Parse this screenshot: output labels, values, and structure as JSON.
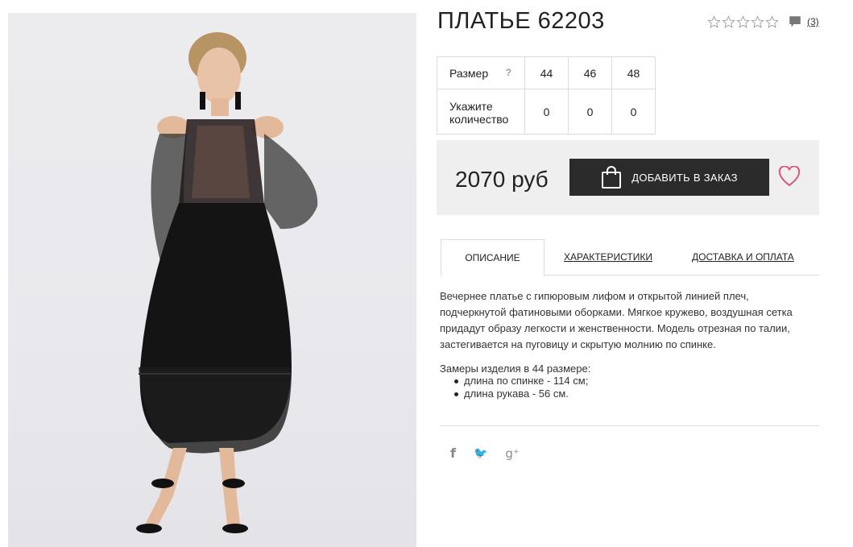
{
  "product": {
    "title": "ПЛАТЬЕ 62203",
    "rating_stars": 5,
    "rating_filled": 0,
    "review_count": "(3)",
    "price": "2070 руб",
    "add_to_cart_label": "ДОБАВИТЬ В ЗАКАЗ",
    "image_icon": "dress-photo"
  },
  "sizes": {
    "size_label": "Размер",
    "help_mark": "?",
    "qty_label": "Укажите количество",
    "columns": [
      "44",
      "46",
      "48"
    ],
    "quantities": [
      "0",
      "0",
      "0"
    ]
  },
  "tabs": [
    "ОПИСАНИЕ",
    "ХАРАКТЕРИСТИКИ",
    "ДОСТАВКА И ОПЛАТА"
  ],
  "description": {
    "text": "Вечернее платье с гипюровым лифом и открытой линией плеч, подчеркнутой фатиновыми оборками. Мягкое кружево, воздушная сетка придадут образу легкости и женственности. Модель отрезная по талии, застегивается на пуговицу и скрытую молнию по спинке.",
    "measures_title": "Замеры изделия в 44 размере:",
    "measures": [
      "длина по спинке - 114 см;",
      "длина рукава - 56 см."
    ]
  },
  "social": {
    "facebook": "f",
    "twitter": "🐦",
    "google": "g⁺"
  },
  "colors": {
    "button": "#2b2b2b",
    "heart": "#d9567a",
    "panel": "#efefef"
  }
}
